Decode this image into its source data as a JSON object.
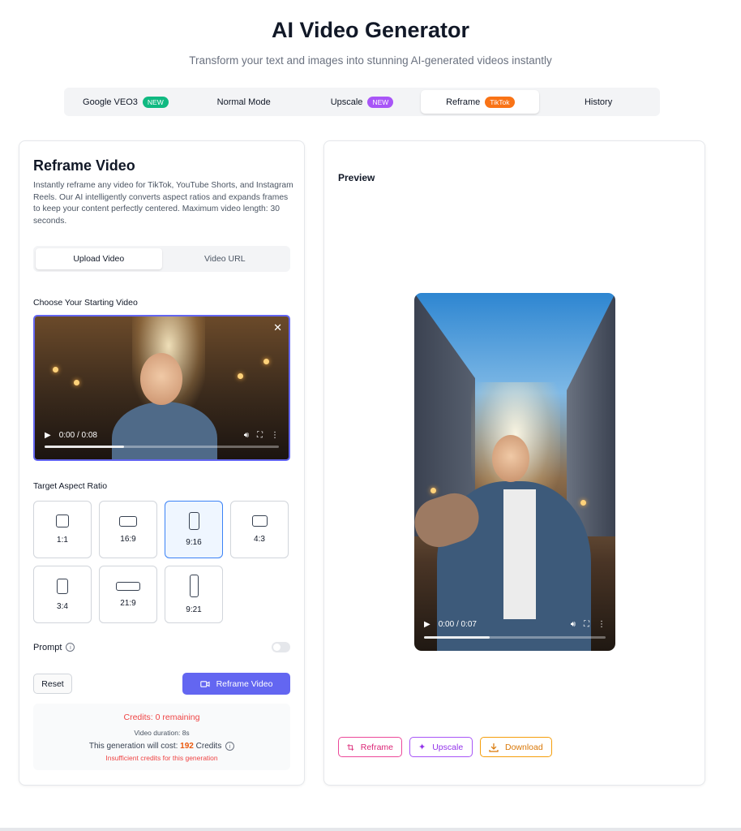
{
  "header": {
    "title": "AI Video Generator",
    "subtitle": "Transform your text and images into stunning AI-generated videos instantly"
  },
  "tabs": [
    {
      "label": "Google VEO3",
      "badge": "NEW",
      "badge_color": "#10b981"
    },
    {
      "label": "Normal Mode",
      "badge": "",
      "badge_color": ""
    },
    {
      "label": "Upscale",
      "badge": "NEW",
      "badge_color": "#a855f7"
    },
    {
      "label": "Reframe",
      "badge": "TikTok",
      "badge_color": "#f97316"
    },
    {
      "label": "History",
      "badge": "",
      "badge_color": ""
    }
  ],
  "active_tab": "Reframe",
  "left": {
    "title": "Reframe Video",
    "description": "Instantly reframe any video for TikTok, YouTube Shorts, and Instagram Reels. Our AI intelligently converts aspect ratios and expands frames to keep your content perfectly centered. Maximum video length: 30 seconds.",
    "source_options": [
      "Upload Video",
      "Video URL"
    ],
    "source_selected": "Upload Video",
    "starting_video_label": "Choose Your Starting Video",
    "video": {
      "time": "0:00 / 0:08",
      "progress": 0.34
    },
    "aspect_label": "Target Aspect Ratio",
    "ratios": [
      "1:1",
      "16:9",
      "9:16",
      "4:3",
      "3:4",
      "21:9",
      "9:21"
    ],
    "ratio_selected": "9:16",
    "prompt_label": "Prompt",
    "prompt_enabled": false,
    "reset_label": "Reset",
    "reframe_label": "Reframe Video",
    "credits": {
      "remaining": "Credits: 0 remaining",
      "duration": "Video duration: 8s",
      "cost_prefix": "This generation will cost:",
      "cost_value": "192",
      "cost_suffix": "Credits",
      "warning": "Insufficient credits for this generation"
    }
  },
  "right": {
    "preview_label": "Preview",
    "video": {
      "time": "0:00 / 0:07",
      "progress": 0.36
    },
    "actions": {
      "reframe": "Reframe",
      "upscale": "Upscale",
      "download": "Download"
    }
  },
  "colors": {
    "accent": "#6366f1",
    "selected_border": "#3b82f6",
    "error": "#ef4444",
    "cost": "#ea580c"
  }
}
